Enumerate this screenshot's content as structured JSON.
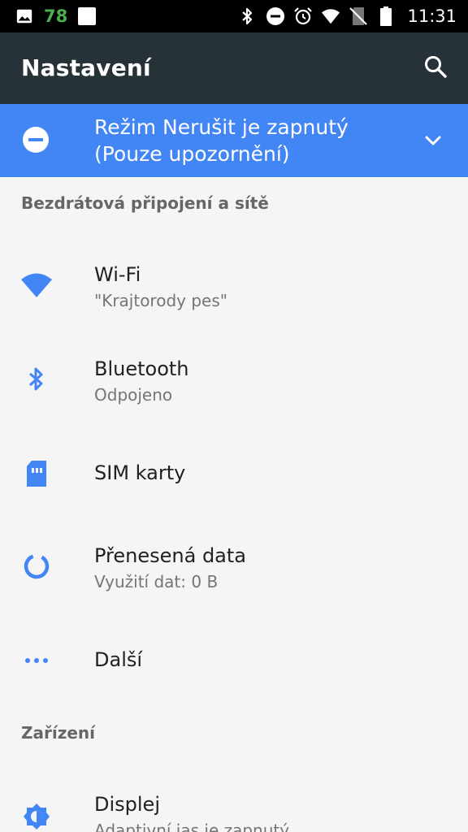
{
  "status_bar": {
    "notification_count": "78",
    "time": "11:31",
    "icons": [
      "image-icon",
      "square-icon",
      "bluetooth-icon",
      "dnd-icon",
      "alarm-icon",
      "wifi-icon",
      "no-sim-icon",
      "battery-icon"
    ]
  },
  "app_bar": {
    "title": "Nastavení",
    "search_icon": "search-icon"
  },
  "banner": {
    "text_line1": "Režim Nerušit je zapnutý",
    "text_line2": "(Pouze upozornění)",
    "icon": "dnd-icon",
    "expand_icon": "chevron-down-icon",
    "color": "#4285f4"
  },
  "sections": {
    "wireless": {
      "title": "Bezdrátová připojení a sítě",
      "items": [
        {
          "title": "Wi-Fi",
          "subtitle": "\"Krajtorody pes\"",
          "icon": "wifi-icon"
        },
        {
          "title": "Bluetooth",
          "subtitle": "Odpojeno",
          "icon": "bluetooth-icon"
        },
        {
          "title": "SIM karty",
          "icon": "sim-card-icon"
        },
        {
          "title": "Přenesená data",
          "subtitle": "Využití dat: 0 B",
          "icon": "data-usage-icon"
        },
        {
          "title": "Další",
          "icon": "more-icon"
        }
      ]
    },
    "device": {
      "title": "Zařízení",
      "items": [
        {
          "title": "Displej",
          "subtitle": "Adaptivní jas je zapnutý",
          "icon": "brightness-icon"
        }
      ]
    }
  },
  "colors": {
    "accent": "#4285f4",
    "appbar": "#263238",
    "background": "#f5f5f5"
  }
}
